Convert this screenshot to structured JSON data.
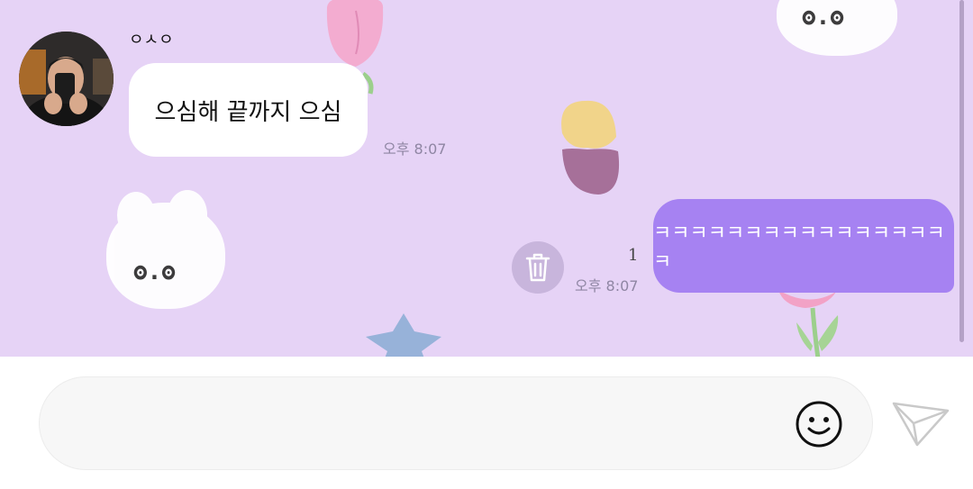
{
  "conversation": {
    "incoming": {
      "sender_name": "ㅇㅅㅇ",
      "text": "으심해 끝까지 으심",
      "time": "오후 8:07"
    },
    "outgoing": {
      "text": "ㅋㅋㅋㅋㅋㅋㅋㅋㅋㅋㅋㅋㅋㅋㅋㅋㅋ",
      "time": "오후 8:07",
      "unread_count": "1"
    }
  },
  "wallpaper": {
    "bunny_face": "ʘ.ʘ"
  },
  "composer": {
    "input_value": "",
    "emoji_icon": "smiley-icon",
    "send_icon": "paper-plane-icon"
  },
  "icons": {
    "delete": "trash-icon"
  },
  "colors": {
    "chat_background": "#e6d3f6",
    "outgoing_bubble": "#a682f2",
    "incoming_bubble": "#ffffff",
    "timestamp": "#8f86a3"
  }
}
